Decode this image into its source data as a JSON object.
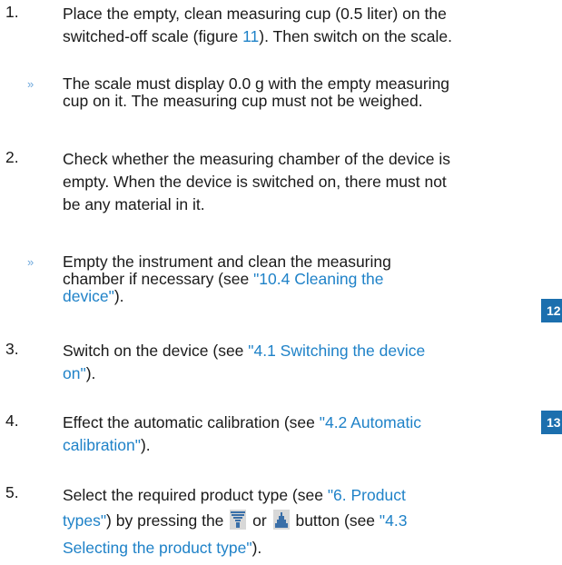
{
  "steps": [
    {
      "number": "1.",
      "lines": [
        "Place the empty, clean measuring cup (0.5 liter) on the"
      ],
      "pre": "switched-off scale (figure ",
      "link": "11",
      "post": "). Then switch on the scale."
    },
    {
      "number": "»",
      "lines": [
        "The scale must display 0.0 g with the empty measuring",
        "cup on it. The measuring cup must not be weighed."
      ]
    },
    {
      "number": "2.",
      "lines": [
        "Check whether the measuring chamber of the device is",
        "empty. When the device is switched on, there must not",
        "be any material in it."
      ]
    },
    {
      "number": "»",
      "lines": [
        "Empty the instrument and clean the measuring"
      ],
      "pre": "chamber if necessary (see ",
      "link": "\"10.4 Cleaning the",
      "link2": "device\"",
      "post": ")."
    },
    {
      "number": "3.",
      "pre": "Switch on the device (see ",
      "link": "\"4.1 Switching the device",
      "link2": "on\"",
      "post": ")."
    },
    {
      "number": "4.",
      "pre": "Effect the automatic calibration (see ",
      "link": "\"4.2 Automatic",
      "link2": "calibration\"",
      "post": ")."
    },
    {
      "number": "5.",
      "pre": "Select the required product type (see ",
      "link": "\"6. Product",
      "link2": "types\"",
      "mid": ") by pressing the ",
      "or_word": "or",
      "after_icons": "button (see ",
      "link3": "\"4.3",
      "link4": "Selecting the product type\"",
      "post": ")."
    }
  ],
  "badges": [
    "12",
    "13"
  ],
  "icons": [
    "funnel-icon",
    "pile-icon"
  ]
}
